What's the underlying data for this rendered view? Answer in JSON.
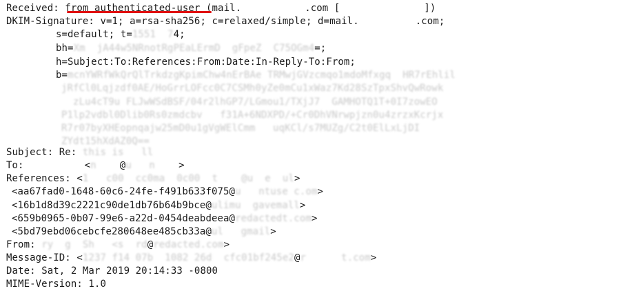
{
  "header": {
    "received": {
      "label": "Received:",
      "value": "from authenticated-user",
      "rest1": "(mail.",
      "rest2": ".com [",
      "rest3": "])"
    },
    "dkim": {
      "line1_a": "DKIM-Signature: v=1; a=rsa-sha256; c=relaxed/simple; d=mail.",
      "line1_b": ".com;",
      "s_line": "s=default; t=",
      "s_line_tail": "4;",
      "bh_label": "bh=",
      "bh_visible_tail": "=;",
      "h_line": "h=Subject:To:References:From:Date:In-Reply-To:From;",
      "b_label": "b="
    },
    "subject": {
      "label": "Subject:",
      "value_prefix": "Re:"
    },
    "to": {
      "label": "To:",
      "value": "<",
      "tail": "@",
      "end": ">"
    },
    "references": {
      "label": "References:",
      "first_prefix": "<",
      "items": [
        {
          "id": "<aa67fad0-1648-60c6-24fe-f491b633f075@",
          "end": ">"
        },
        {
          "id": "<16b1d8d39c2221c90de1db76b64b9bce@",
          "end": ">"
        },
        {
          "id": "<659b0965-0b07-99e6-a22d-0454deabdeea@",
          "end": ">"
        },
        {
          "id": "<5bd79ebd06cebcfe280648ee485cb33a@",
          "end": ">"
        }
      ]
    },
    "from": {
      "label": "From:",
      "at": "@",
      "end": ">"
    },
    "message_id": {
      "label": "Message-ID:",
      "prefix": "<",
      "at": "@",
      "end": ">"
    },
    "date": {
      "label": "Date:",
      "value": "Sat, 2 Mar 2019 20:14:33 -0800"
    },
    "mime": {
      "label": "MIME-Version:",
      "value": "1.0"
    }
  },
  "colors": {
    "underline": "#e01010",
    "text": "#1a1a1a"
  }
}
